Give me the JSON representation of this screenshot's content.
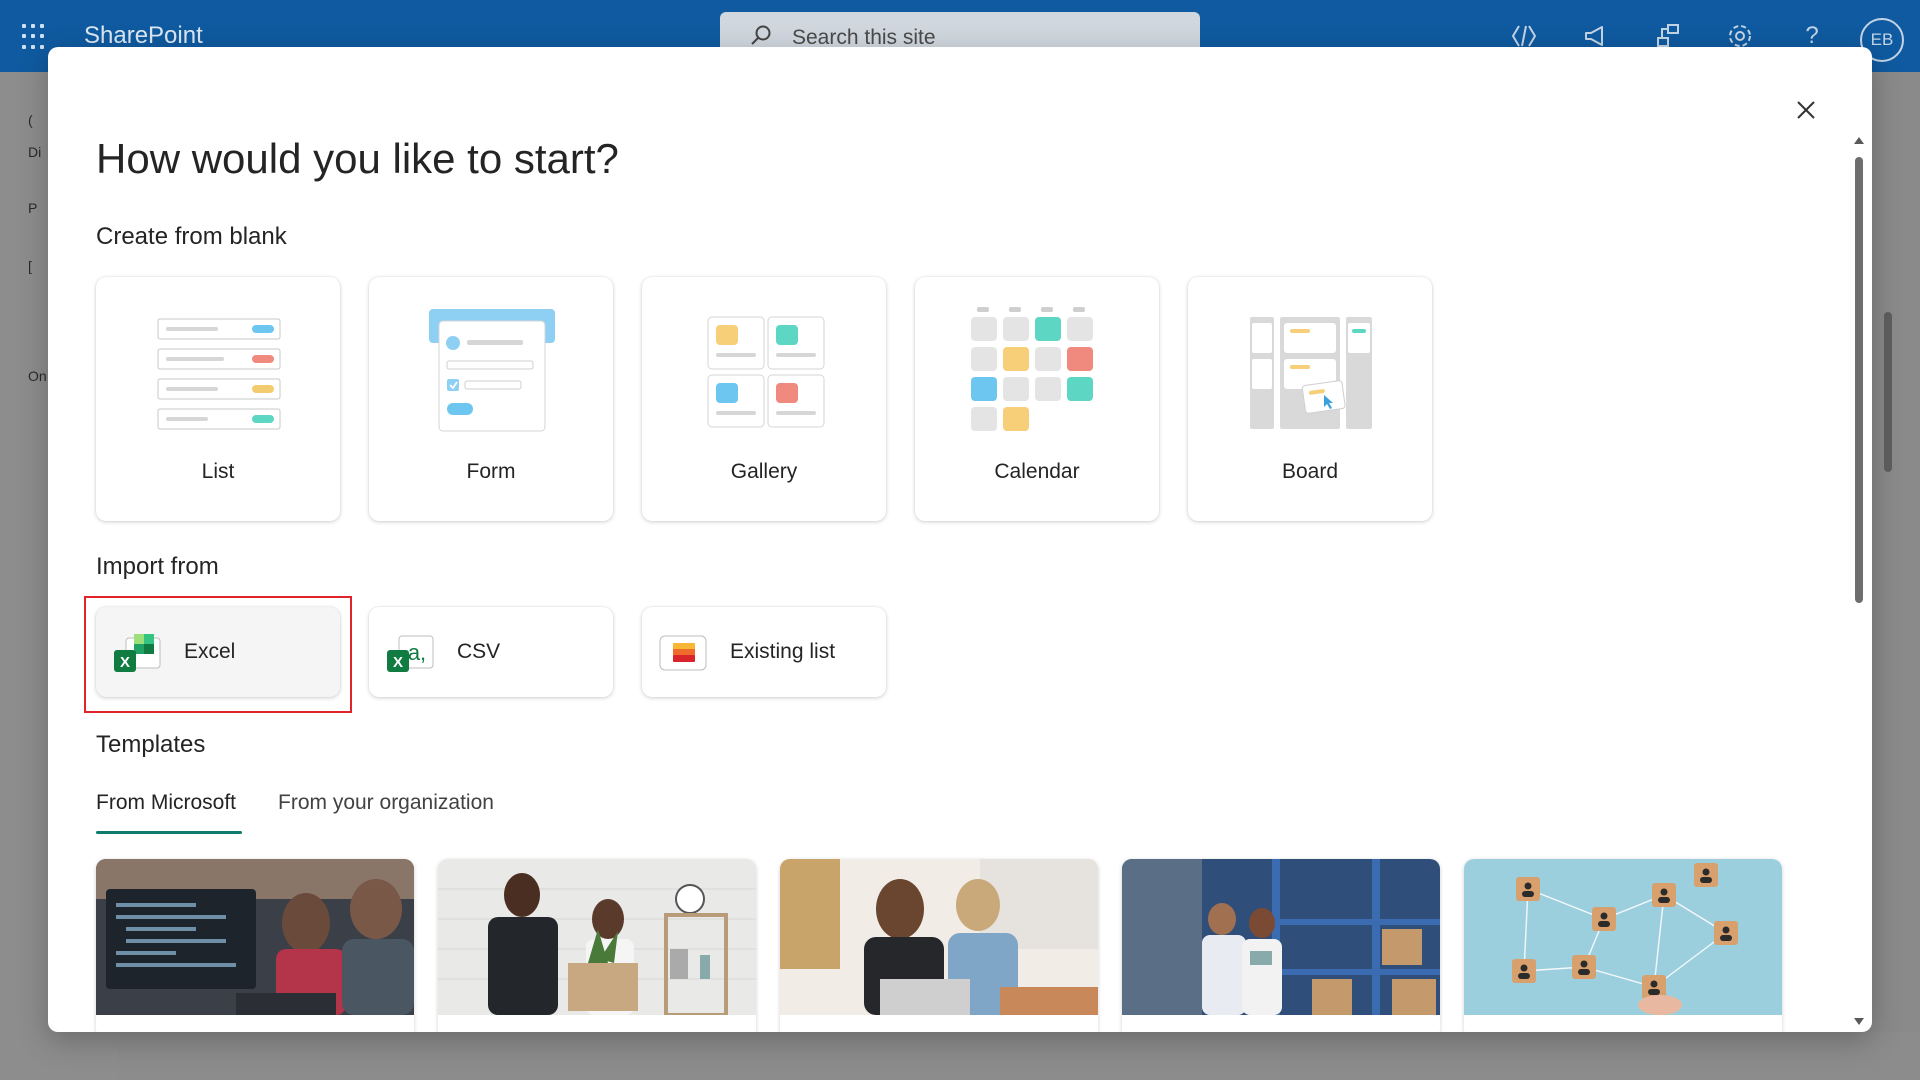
{
  "app": {
    "name": "SharePoint",
    "search_placeholder": "Search this site",
    "user_initials": "EB",
    "top_icons": [
      "code-icon",
      "megaphone-icon",
      "flow-icon",
      "gear-icon",
      "help-icon"
    ]
  },
  "dialog": {
    "title": "How would you like to start?",
    "close_icon": "close-icon",
    "create_section": {
      "title": "Create from blank",
      "cards": [
        {
          "label": "List",
          "icon": "list-illustration"
        },
        {
          "label": "Form",
          "icon": "form-illustration"
        },
        {
          "label": "Gallery",
          "icon": "gallery-illustration"
        },
        {
          "label": "Calendar",
          "icon": "calendar-illustration"
        },
        {
          "label": "Board",
          "icon": "board-illustration"
        }
      ]
    },
    "import_section": {
      "title": "Import from",
      "items": [
        {
          "label": "Excel",
          "icon": "excel-icon",
          "highlighted": true
        },
        {
          "label": "CSV",
          "icon": "csv-icon"
        },
        {
          "label": "Existing list",
          "icon": "existing-list-icon"
        }
      ]
    },
    "templates_section": {
      "title": "Templates",
      "tabs": [
        {
          "label": "From Microsoft",
          "active": true
        },
        {
          "label": "From your organization",
          "active": false
        }
      ],
      "items": [
        {
          "icon": "developers-photo"
        },
        {
          "icon": "employee-onboarding-photo"
        },
        {
          "icon": "colleagues-laptop-photo"
        },
        {
          "icon": "warehouse-photo"
        },
        {
          "icon": "network-people-photo"
        }
      ]
    }
  },
  "colors": {
    "topbar": "#0f5aa0",
    "tab_accent": "#0f7b6c",
    "highlight": "#e0242a"
  }
}
